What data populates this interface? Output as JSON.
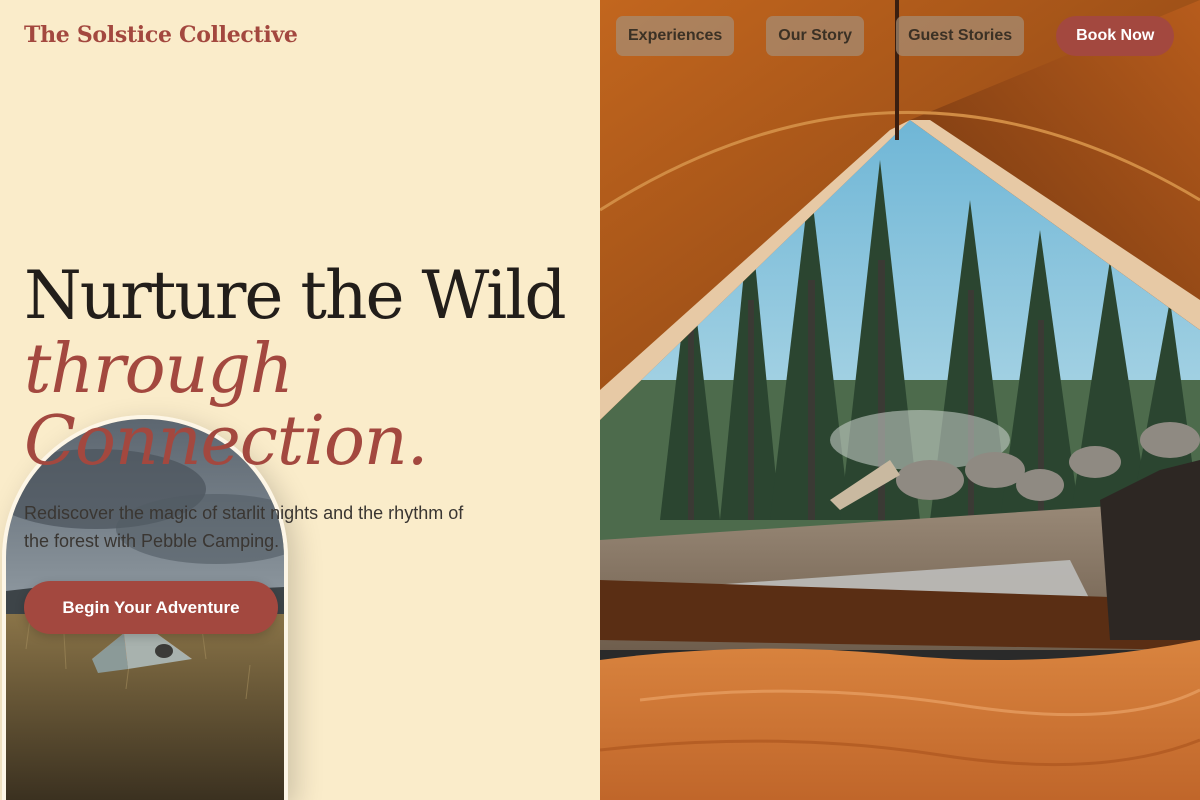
{
  "brand": "The Solstice Collective",
  "nav": {
    "items": [
      "Experiences",
      "Our Story",
      "Guest Stories"
    ],
    "cta": "Book Now"
  },
  "hero": {
    "line1": "Nurture the Wild",
    "line2": "through",
    "line3": "Connection.",
    "subtext": "Rediscover the magic of starlit nights and the rhythm of the forest with Pebble Camping.",
    "cta": "Begin Your Adventure"
  },
  "colors": {
    "background": "#faecca",
    "accent": "#a3483f",
    "text": "#221e1a"
  },
  "images": {
    "hero": "tent-interior-forest-view-photo",
    "inset": "tent-in-meadow-photo"
  }
}
